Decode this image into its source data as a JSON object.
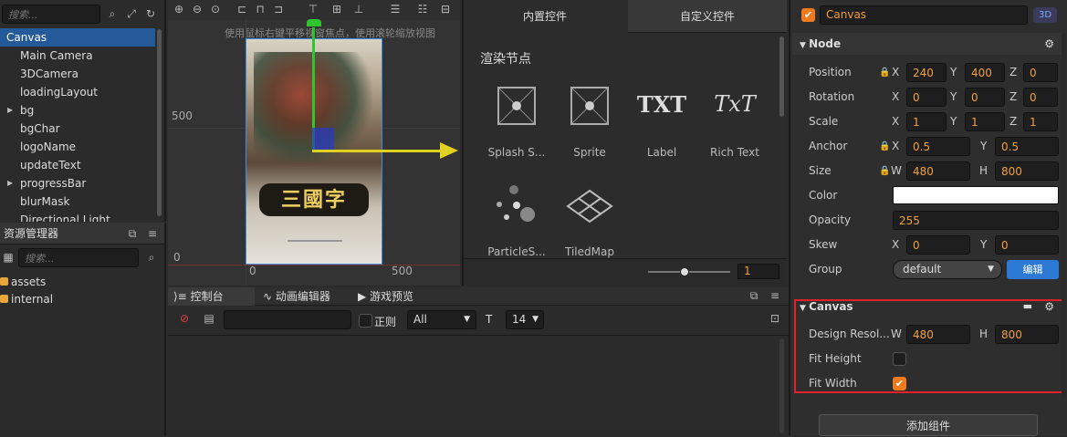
{
  "hierarchy": {
    "search_placeholder": "搜索...",
    "items": [
      {
        "label": "Canvas"
      },
      {
        "label": "Main Camera"
      },
      {
        "label": "3DCamera"
      },
      {
        "label": "loadingLayout"
      },
      {
        "label": "bg"
      },
      {
        "label": "bgChar"
      },
      {
        "label": "logoName"
      },
      {
        "label": "updateText"
      },
      {
        "label": "progressBar"
      },
      {
        "label": "blurMask"
      },
      {
        "label": "Directional Light"
      }
    ]
  },
  "assets": {
    "title": "资源管理器",
    "search_placeholder": "搜索...",
    "items": [
      {
        "label": "assets"
      },
      {
        "label": "internal"
      }
    ]
  },
  "scene": {
    "hint": "使用鼠标右键平移视窗焦点，使用滚轮缩放视图",
    "ruler": {
      "y500": "500",
      "y0": "0",
      "x0": "0",
      "x500": "500"
    },
    "game_title": "三國字"
  },
  "widgets": {
    "tabs": [
      {
        "label": "内置控件"
      },
      {
        "label": "自定义控件"
      }
    ],
    "section_title": "渲染节点",
    "items": [
      {
        "label": "Splash S...",
        "icon": "splash-sprite-icon"
      },
      {
        "label": "Sprite",
        "icon": "sprite-icon"
      },
      {
        "label": "Label",
        "icon": "label-icon",
        "glyph": "TXT"
      },
      {
        "label": "Rich Text",
        "icon": "rich-text-icon",
        "glyph": "TxT"
      },
      {
        "label": "ParticleS...",
        "icon": "particle-icon"
      },
      {
        "label": "TiledMap",
        "icon": "tiledmap-icon"
      }
    ],
    "zoom_value": "1"
  },
  "console": {
    "tabs": [
      {
        "label": "控制台"
      },
      {
        "label": "动画编辑器"
      },
      {
        "label": "游戏预览"
      }
    ],
    "regex_label": "正则",
    "filter_value": "All",
    "font_size_value": "14"
  },
  "inspector": {
    "node_name": "Canvas",
    "badge_3d": "3D",
    "node_section": "Node",
    "position": {
      "label": "Position",
      "x": "240",
      "y": "400",
      "z": "0"
    },
    "rotation": {
      "label": "Rotation",
      "x": "0",
      "y": "0",
      "z": "0"
    },
    "scale": {
      "label": "Scale",
      "x": "1",
      "y": "1",
      "z": "1"
    },
    "anchor": {
      "label": "Anchor",
      "x": "0.5",
      "y": "0.5"
    },
    "size": {
      "label": "Size",
      "w": "480",
      "h": "800"
    },
    "color": {
      "label": "Color",
      "value": "#ffffff"
    },
    "opacity": {
      "label": "Opacity",
      "value": "255"
    },
    "skew": {
      "label": "Skew",
      "x": "0",
      "y": "0"
    },
    "group": {
      "label": "Group",
      "value": "default",
      "edit_label": "编辑"
    },
    "canvas_section": "Canvas",
    "design_resolution": {
      "label": "Design Resol...",
      "w": "480",
      "h": "800"
    },
    "fit_height": {
      "label": "Fit Height",
      "checked": false
    },
    "fit_width": {
      "label": "Fit Width",
      "checked": true
    },
    "add_component_label": "添加组件",
    "axis_labels": {
      "x": "X",
      "y": "Y",
      "z": "Z",
      "w": "W",
      "h": "H"
    }
  }
}
